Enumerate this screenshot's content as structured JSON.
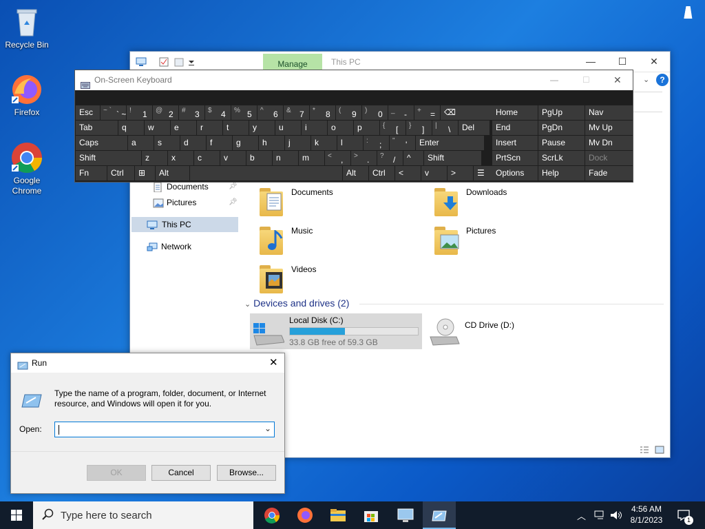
{
  "desktop": {
    "icons": [
      {
        "label": "Recycle Bin",
        "icon": "recycle-bin-icon"
      },
      {
        "label": "Firefox",
        "icon": "firefox-icon"
      },
      {
        "label": "Google Chrome",
        "icon": "chrome-icon"
      }
    ]
  },
  "explorer": {
    "ribbon_tab": "Manage",
    "title": "This PC",
    "nav": [
      {
        "label": "Documents",
        "icon": "documents-icon",
        "pinned": true
      },
      {
        "label": "Pictures",
        "icon": "pictures-icon",
        "pinned": true
      },
      {
        "label": "This PC",
        "icon": "this-pc-icon",
        "selected": true
      },
      {
        "label": "Network",
        "icon": "network-icon"
      }
    ],
    "folders": [
      "Documents",
      "Downloads",
      "Music",
      "Pictures",
      "Videos"
    ],
    "devices_header": "Devices and drives (2)",
    "drives": [
      {
        "name": "Local Disk (C:)",
        "free": "33.8 GB free of 59.3 GB",
        "used_fraction": 0.43
      },
      {
        "name": "CD Drive (D:)"
      }
    ]
  },
  "osk": {
    "title": "On-Screen Keyboard",
    "rows": [
      [
        {
          "k": "Esc"
        },
        {
          "k": "` ~",
          "s": "~ `"
        },
        {
          "k": "1",
          "s": "!"
        },
        {
          "k": "2",
          "s": "@"
        },
        {
          "k": "3",
          "s": "#"
        },
        {
          "k": "4",
          "s": "$"
        },
        {
          "k": "5",
          "s": "%"
        },
        {
          "k": "6",
          "s": "^"
        },
        {
          "k": "7",
          "s": "&"
        },
        {
          "k": "8",
          "s": "*"
        },
        {
          "k": "9",
          "s": "("
        },
        {
          "k": "0",
          "s": ")"
        },
        {
          "k": "-",
          "s": "_"
        },
        {
          "k": "=",
          "s": "+"
        },
        {
          "k": "⌫"
        }
      ],
      [
        {
          "k": "Tab"
        },
        {
          "k": "q"
        },
        {
          "k": "w"
        },
        {
          "k": "e"
        },
        {
          "k": "r"
        },
        {
          "k": "t"
        },
        {
          "k": "y"
        },
        {
          "k": "u"
        },
        {
          "k": "i"
        },
        {
          "k": "o"
        },
        {
          "k": "p"
        },
        {
          "k": "[",
          "s": "{"
        },
        {
          "k": "]",
          "s": "}"
        },
        {
          "k": "\\",
          "s": "|"
        },
        {
          "k": "Del"
        }
      ],
      [
        {
          "k": "Caps"
        },
        {
          "k": "a"
        },
        {
          "k": "s"
        },
        {
          "k": "d"
        },
        {
          "k": "f"
        },
        {
          "k": "g"
        },
        {
          "k": "h"
        },
        {
          "k": "j"
        },
        {
          "k": "k"
        },
        {
          "k": "l"
        },
        {
          "k": ";",
          "s": ":"
        },
        {
          "k": "'",
          "s": "\""
        },
        {
          "k": "Enter"
        }
      ],
      [
        {
          "k": "Shift"
        },
        {
          "k": "z"
        },
        {
          "k": "x"
        },
        {
          "k": "c"
        },
        {
          "k": "v"
        },
        {
          "k": "b"
        },
        {
          "k": "n"
        },
        {
          "k": "m"
        },
        {
          "k": ",",
          "s": "<"
        },
        {
          "k": ".",
          "s": ">"
        },
        {
          "k": "/",
          "s": "?"
        },
        {
          "k": "^"
        },
        {
          "k": "Shift"
        }
      ],
      [
        {
          "k": "Fn"
        },
        {
          "k": "Ctrl"
        },
        {
          "k": "⊞"
        },
        {
          "k": "Alt"
        },
        {
          "k": ""
        },
        {
          "k": "Alt"
        },
        {
          "k": "Ctrl"
        },
        {
          "k": "<"
        },
        {
          "k": "v"
        },
        {
          "k": ">"
        },
        {
          "k": "☰"
        }
      ]
    ],
    "nav_keys": [
      [
        "Home",
        "PgUp",
        "Nav"
      ],
      [
        "End",
        "PgDn",
        "Mv Up"
      ],
      [
        "Insert",
        "Pause",
        "Mv Dn"
      ],
      [
        "PrtScn",
        "ScrLk",
        "Dock"
      ],
      [
        "Options",
        "Help",
        "Fade"
      ]
    ]
  },
  "run": {
    "title": "Run",
    "desc": "Type the name of a program, folder, document, or Internet resource, and Windows will open it for you.",
    "open_label": "Open:",
    "value": "",
    "ok": "OK",
    "cancel": "Cancel",
    "browse": "Browse..."
  },
  "taskbar": {
    "search_placeholder": "Type here to search",
    "apps": [
      "chrome-icon",
      "firefox-icon",
      "file-explorer-icon",
      "store-icon",
      "remote-desktop-icon",
      "run-icon"
    ],
    "time": "4:56 AM",
    "date": "8/1/2023",
    "notifications": "1"
  }
}
